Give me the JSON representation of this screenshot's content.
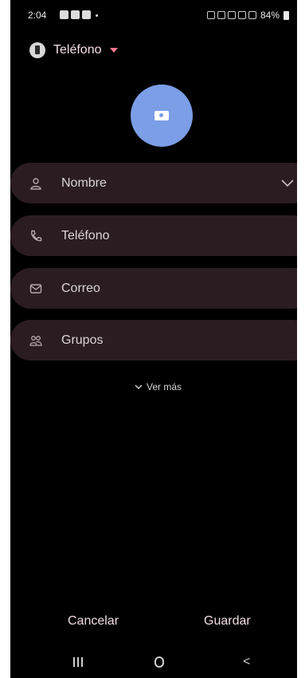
{
  "status_bar": {
    "time": "2:04",
    "battery": "84%"
  },
  "account": {
    "label": "Teléfono",
    "icon": "phone-icon"
  },
  "photo": {
    "icon": "camera-icon",
    "color": "#7b9ee6"
  },
  "fields": [
    {
      "label": "Nombre",
      "icon": "person-icon",
      "expandable": true
    },
    {
      "label": "Teléfono",
      "icon": "phone-handset-icon"
    },
    {
      "label": "Correo",
      "icon": "mail-icon"
    },
    {
      "label": "Grupos",
      "icon": "group-icon"
    }
  ],
  "more": {
    "label": "Ver más"
  },
  "actions": {
    "cancel": "Cancelar",
    "save": "Guardar"
  },
  "colors": {
    "field_bg": "#2b1c22",
    "accent": "#ff7a90"
  }
}
